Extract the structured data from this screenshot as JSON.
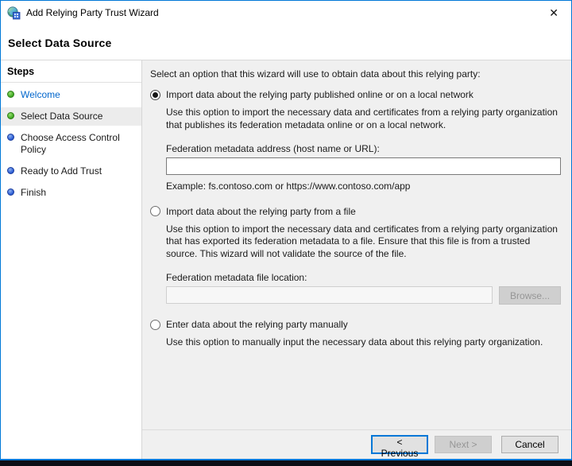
{
  "window": {
    "title": "Add Relying Party Trust Wizard",
    "close_glyph": "✕"
  },
  "header": {
    "title": "Select Data Source"
  },
  "sidebar": {
    "heading": "Steps",
    "items": [
      {
        "label": "Welcome",
        "state": "completed-link",
        "bullet": "green"
      },
      {
        "label": "Select Data Source",
        "state": "current",
        "bullet": "green"
      },
      {
        "label": "Choose Access Control Policy",
        "state": "pending",
        "bullet": "blue"
      },
      {
        "label": "Ready to Add Trust",
        "state": "pending",
        "bullet": "blue"
      },
      {
        "label": "Finish",
        "state": "pending",
        "bullet": "blue"
      }
    ]
  },
  "main": {
    "intro": "Select an option that this wizard will use to obtain data about this relying party:",
    "options": [
      {
        "label": "Import data about the relying party published online or on a local network",
        "selected": true,
        "description": "Use this option to import the necessary data and certificates from a relying party organization that publishes its federation metadata online or on a local network.",
        "field_label": "Federation metadata address (host name or URL):",
        "field_value": "",
        "example": "Example: fs.contoso.com or https://www.contoso.com/app"
      },
      {
        "label": "Import data about the relying party from a file",
        "selected": false,
        "description": "Use this option to import the necessary data and certificates from a relying party organization that has exported its federation metadata to a file. Ensure that this file is from a trusted source.  This wizard will not validate the source of the file.",
        "field_label": "Federation metadata file location:",
        "field_value": "",
        "browse_label": "Browse..."
      },
      {
        "label": "Enter data about the relying party manually",
        "selected": false,
        "description": "Use this option to manually input the necessary data about this relying party organization."
      }
    ]
  },
  "footer": {
    "previous_label": "< Previous",
    "next_label": "Next >",
    "cancel_label": "Cancel"
  },
  "colors": {
    "accent_border": "#0078d7",
    "link_blue": "#0066cc",
    "step_done_green": "#44ad27",
    "step_pending_blue": "#2e5fd6",
    "content_background": "#f0f0f0",
    "highlight_row": "#ececec"
  }
}
